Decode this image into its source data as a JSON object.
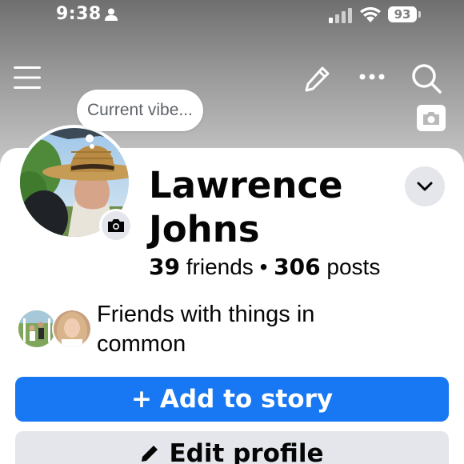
{
  "status_bar": {
    "time": "9:38",
    "battery_level": "93",
    "icons": [
      "person-icon",
      "cellular-signal-icon",
      "wifi-icon",
      "battery-icon"
    ]
  },
  "top_nav": {
    "icons": [
      "hamburger-menu-icon",
      "pencil-icon",
      "more-dots-icon",
      "search-icon",
      "camera-icon"
    ]
  },
  "note": {
    "text": "Current vibe..."
  },
  "profile": {
    "name": "Lawrence Johns",
    "friends_count": "39",
    "friends_label": "friends",
    "separator": "•",
    "posts_count": "306",
    "posts_label": "posts"
  },
  "mutual": {
    "text": "Friends with things in common"
  },
  "actions": {
    "add_story_icon": "+",
    "add_story_label": "Add to story",
    "edit_profile_label": "Edit profile"
  },
  "colors": {
    "primary": "#1877f2",
    "secondary_button": "#e4e6eb",
    "text": "#050505"
  }
}
